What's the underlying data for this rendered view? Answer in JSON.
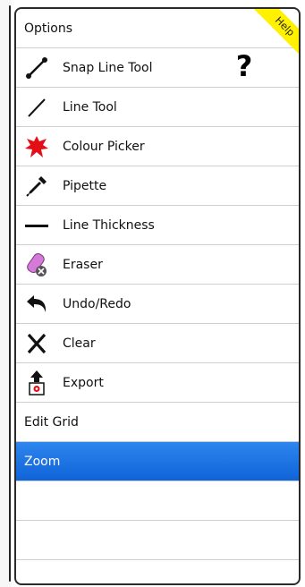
{
  "panel": {
    "title": "Options",
    "help_label": "Help",
    "help_icon": "?"
  },
  "menu": {
    "items": [
      {
        "label": "Snap Line Tool",
        "icon": "snap-line-icon"
      },
      {
        "label": "Line Tool",
        "icon": "line-icon"
      },
      {
        "label": "Colour Picker",
        "icon": "paint-splat-icon"
      },
      {
        "label": "Pipette",
        "icon": "pipette-icon"
      },
      {
        "label": "Line Thickness",
        "icon": "line-thickness-icon"
      },
      {
        "label": "Eraser",
        "icon": "eraser-icon"
      },
      {
        "label": "Undo/Redo",
        "icon": "undo-icon"
      },
      {
        "label": "Clear",
        "icon": "clear-x-icon"
      },
      {
        "label": "Export",
        "icon": "export-icon"
      }
    ],
    "plain_items": [
      {
        "label": "Edit Grid"
      },
      {
        "label": "Zoom",
        "selected": true
      }
    ]
  },
  "colors": {
    "selected": "#0f63d8",
    "help_ribbon": "#fff100",
    "colour_picker_red": "#e40e17",
    "eraser_pink": "#d57ad8"
  }
}
